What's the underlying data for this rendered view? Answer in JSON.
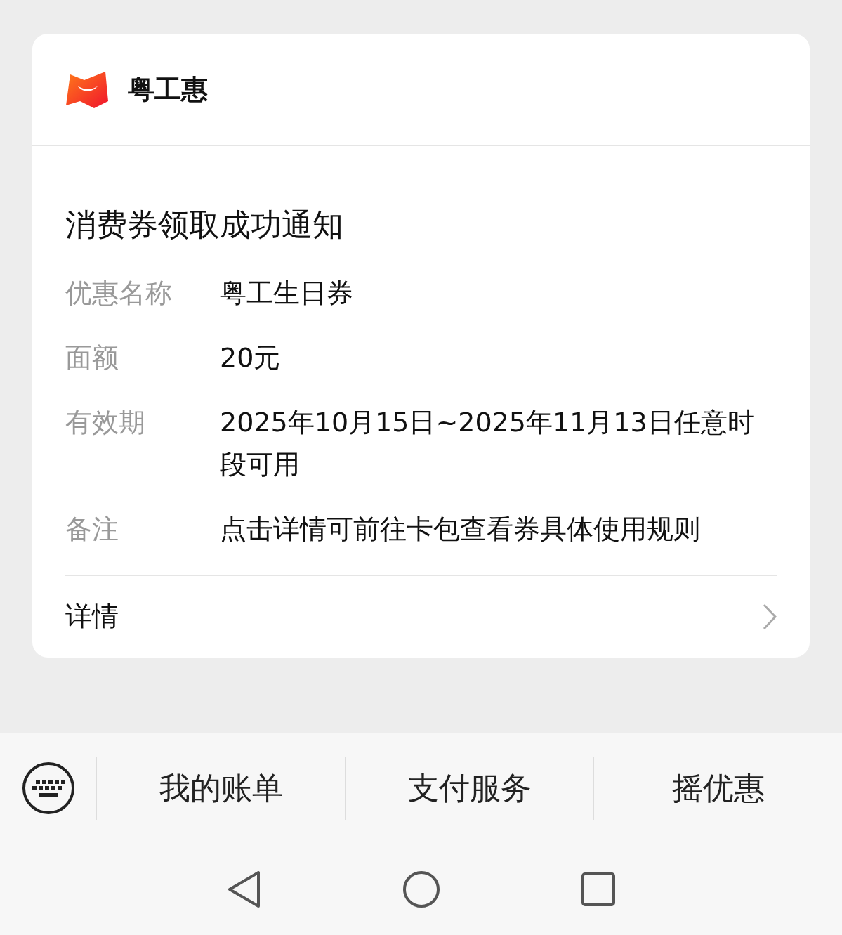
{
  "account": {
    "name": "粤工惠"
  },
  "message": {
    "title": "消费券领取成功通知",
    "fields": [
      {
        "label": "优惠名称",
        "value": "粤工生日券"
      },
      {
        "label": "面额",
        "value": "20元"
      },
      {
        "label": "有效期",
        "value": "2025年10月15日~2025年11月13日任意时段可用"
      },
      {
        "label": "备注",
        "value": "点击详情可前往卡包查看券具体使用规则"
      }
    ],
    "detail_link": "详情"
  },
  "menu": [
    "我的账单",
    "支付服务",
    "摇优惠"
  ]
}
